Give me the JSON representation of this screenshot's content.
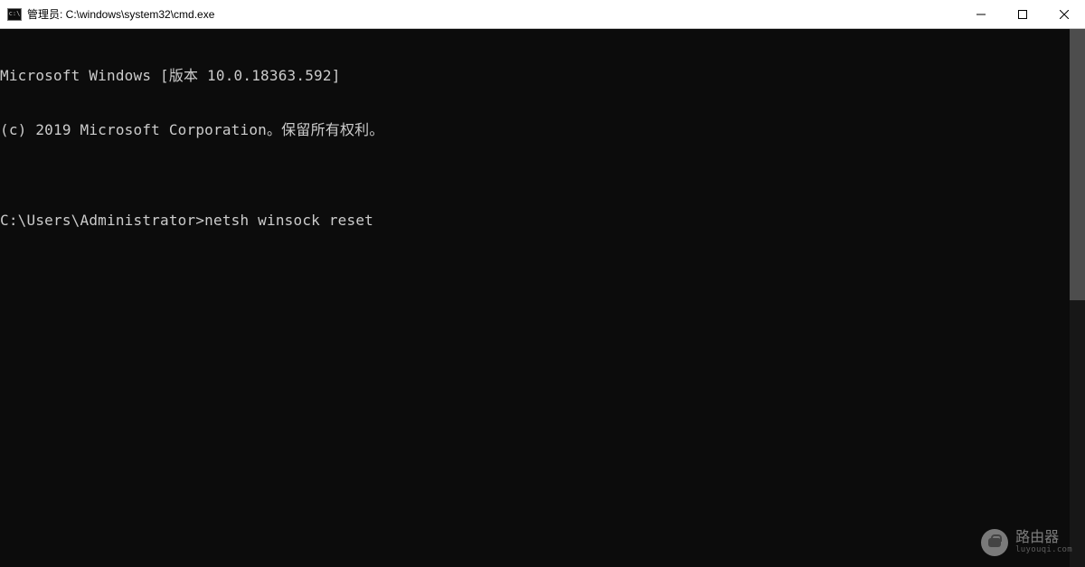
{
  "titlebar": {
    "title": "管理员: C:\\windows\\system32\\cmd.exe"
  },
  "terminal": {
    "line1": "Microsoft Windows [版本 10.0.18363.592]",
    "line2": "(c) 2019 Microsoft Corporation。保留所有权利。",
    "blank": "",
    "prompt": "C:\\Users\\Administrator>",
    "command": "netsh winsock reset"
  },
  "watermark": {
    "title": "路由器",
    "sub": "luyouqi.com"
  }
}
